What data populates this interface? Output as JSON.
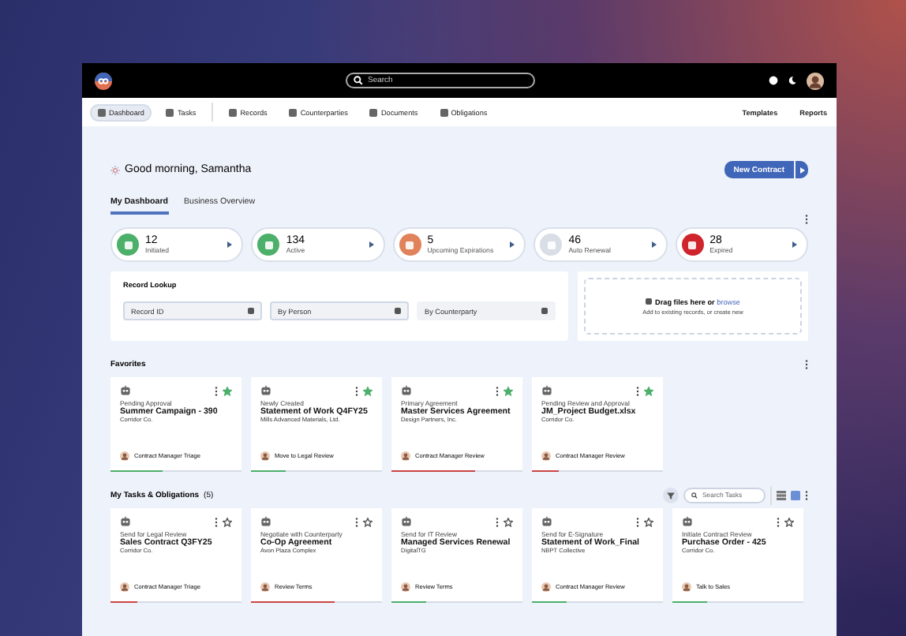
{
  "topbar": {
    "search": {
      "placeholder": "Search"
    }
  },
  "nav": {
    "items": [
      {
        "label": "Dashboard",
        "selected": true
      },
      {
        "label": "Tasks",
        "selected": false
      },
      {
        "label": "Records",
        "selected": false
      },
      {
        "label": "Counterparties",
        "selected": false
      },
      {
        "label": "Documents",
        "selected": false
      },
      {
        "label": "Obligations",
        "selected": false
      }
    ],
    "links": [
      "Templates",
      "Reports"
    ]
  },
  "greeting": "Good morning, Samantha",
  "primary_button": "New Contract",
  "tabs": [
    {
      "label": "My Dashboard",
      "selected": true
    },
    {
      "label": "Business Overview",
      "selected": false
    }
  ],
  "status_tiles": [
    {
      "count": "12",
      "label": "Initiated",
      "color": "#4caf6a"
    },
    {
      "count": "134",
      "label": "Active",
      "color": "#4caf6a"
    },
    {
      "count": "5",
      "label": "Upcoming Expirations",
      "color": "#e0825a"
    },
    {
      "count": "46",
      "label": "Auto Renewal",
      "color": "#d8dde6"
    },
    {
      "count": "28",
      "label": "Expired",
      "color": "#d0242c"
    }
  ],
  "record_lookup": {
    "title": "Record Lookup",
    "fields": [
      {
        "placeholder": "Record ID"
      },
      {
        "placeholder": "By Person"
      },
      {
        "placeholder": "By Counterparty"
      }
    ]
  },
  "upload": {
    "text": "Drag files here or",
    "link": "browse",
    "hint": "Add to existing records, or create new"
  },
  "favorites": {
    "title": "Favorites",
    "cards": [
      {
        "status": "Pending Approval",
        "title": "Summer Campaign - 390",
        "company": "Corridor Co.",
        "assignee": "Contract Manager Triage",
        "starred": true,
        "level": 0.4,
        "color": "#4caf6a"
      },
      {
        "status": "Newly Created",
        "title": "Statement of Work Q4FY25",
        "company": "Mills Advanced Materials, Ltd.",
        "assignee": "Move to Legal Review",
        "starred": true,
        "level": 0.27,
        "color": "#4caf6a"
      },
      {
        "status": "Primary Agreement",
        "title": "Master Services Agreement",
        "company": "Design Partners, Inc.",
        "assignee": "Contract Manager Review",
        "starred": true,
        "level": 0.64,
        "color": "#c94444"
      },
      {
        "status": "Pending Review and Approval",
        "title": "JM_Project Budget.xlsx",
        "company": "Corridor Co.",
        "assignee": "Contract Manager Review",
        "starred": true,
        "level": 0.2,
        "color": "#c94444"
      }
    ]
  },
  "tasks": {
    "title": "My Tasks & Obligations",
    "count": "(5)",
    "search": {
      "placeholder": "Search Tasks"
    },
    "views": [
      {
        "kind": "list",
        "selected": false
      },
      {
        "kind": "grid",
        "selected": true
      }
    ],
    "cards": [
      {
        "status": "Send for Legal Review",
        "title": "Sales Contract Q3FY25",
        "company": "Corridor Co.",
        "assignee": "Contract Manager Triage",
        "starred": false,
        "level": 0.2,
        "color": "#c94444"
      },
      {
        "status": "Negotiate with Counterparty",
        "title": "Co-Op Agreement",
        "company": "Avon Plaza Complex",
        "assignee": "Review Terms",
        "starred": false,
        "level": 0.64,
        "color": "#c94444"
      },
      {
        "status": "Send for IT Review",
        "title": "Managed Services Renewal",
        "company": "DigitalTG",
        "assignee": "Review Terms",
        "starred": false,
        "level": 0.27,
        "color": "#4caf6a"
      },
      {
        "status": "Send for E-Signature",
        "title": "Statement of Work_Final",
        "company": "NBPT Collective",
        "assignee": "Contract Manager Review",
        "starred": false,
        "level": 0.27,
        "color": "#4caf6a"
      },
      {
        "status": "Initiate Contract Review",
        "title": "Purchase Order - 425",
        "company": "Corridor Co.",
        "assignee": "Talk to Sales",
        "starred": false,
        "level": 0.27,
        "color": "#4caf6a"
      }
    ]
  }
}
